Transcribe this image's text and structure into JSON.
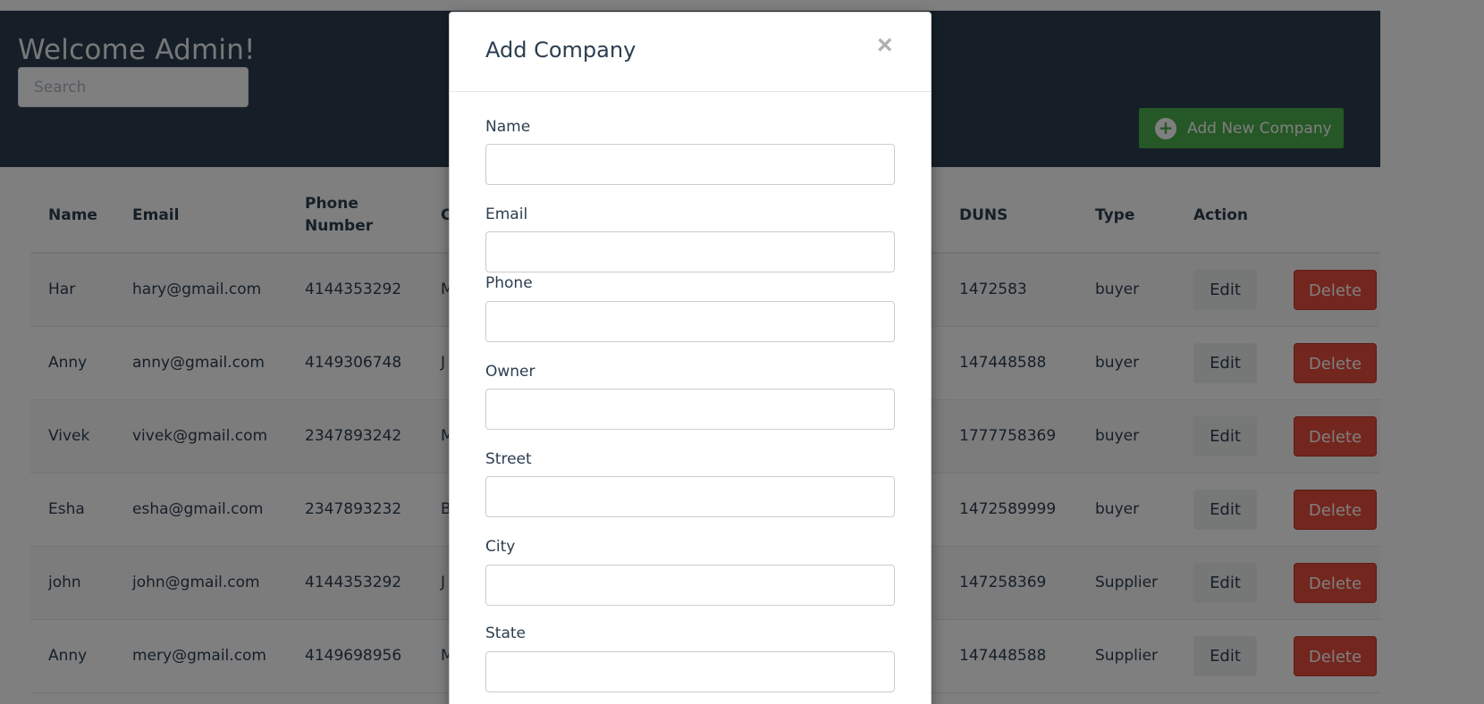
{
  "header": {
    "welcome": "Welcome Admin!",
    "search_placeholder": "Search",
    "add_button_label": "Add New Company",
    "add_button_icon": "plus-circle-icon"
  },
  "table": {
    "columns": [
      "Name",
      "Email",
      "Phone\nNumber",
      "C",
      "DUNS",
      "Type",
      "Action"
    ],
    "rows": [
      {
        "name": "Har",
        "email": "hary@gmail.com",
        "phone": "4144353292",
        "col4": "M",
        "duns": "1472583",
        "type": "buyer",
        "edit": "Edit",
        "delete": "Delete"
      },
      {
        "name": "Anny",
        "email": "anny@gmail.com",
        "phone": "4149306748",
        "col4": "J",
        "duns": "147448588",
        "type": "buyer",
        "edit": "Edit",
        "delete": "Delete"
      },
      {
        "name": "Vivek",
        "email": "vivek@gmail.com",
        "phone": "2347893242",
        "col4": "M",
        "duns": "1777758369",
        "type": "buyer",
        "edit": "Edit",
        "delete": "Delete"
      },
      {
        "name": "Esha",
        "email": "esha@gmail.com",
        "phone": "2347893232",
        "col4": "B",
        "duns": "1472589999",
        "type": "buyer",
        "edit": "Edit",
        "delete": "Delete"
      },
      {
        "name": "john",
        "email": "john@gmail.com",
        "phone": "4144353292",
        "col4": "J",
        "duns": "147258369",
        "type": "Supplier",
        "edit": "Edit",
        "delete": "Delete"
      },
      {
        "name": "Anny",
        "email": "mery@gmail.com",
        "phone": "4149698956",
        "col4": "M",
        "duns": "147448588",
        "type": "Supplier",
        "edit": "Edit",
        "delete": "Delete"
      }
    ]
  },
  "modal": {
    "title": "Add Company",
    "close_symbol": "×",
    "fields": [
      {
        "label": "Name",
        "value": ""
      },
      {
        "label": "Email",
        "value": ""
      },
      {
        "label": "Phone",
        "value": ""
      },
      {
        "label": "Owner",
        "value": ""
      },
      {
        "label": "Street",
        "value": ""
      },
      {
        "label": "City",
        "value": ""
      },
      {
        "label": "State",
        "value": ""
      }
    ]
  },
  "colors": {
    "header_bg": "#2c3e50",
    "add_button": "#4cae4c",
    "delete_button": "#e74c3c",
    "edit_button": "#ecf0f1"
  }
}
